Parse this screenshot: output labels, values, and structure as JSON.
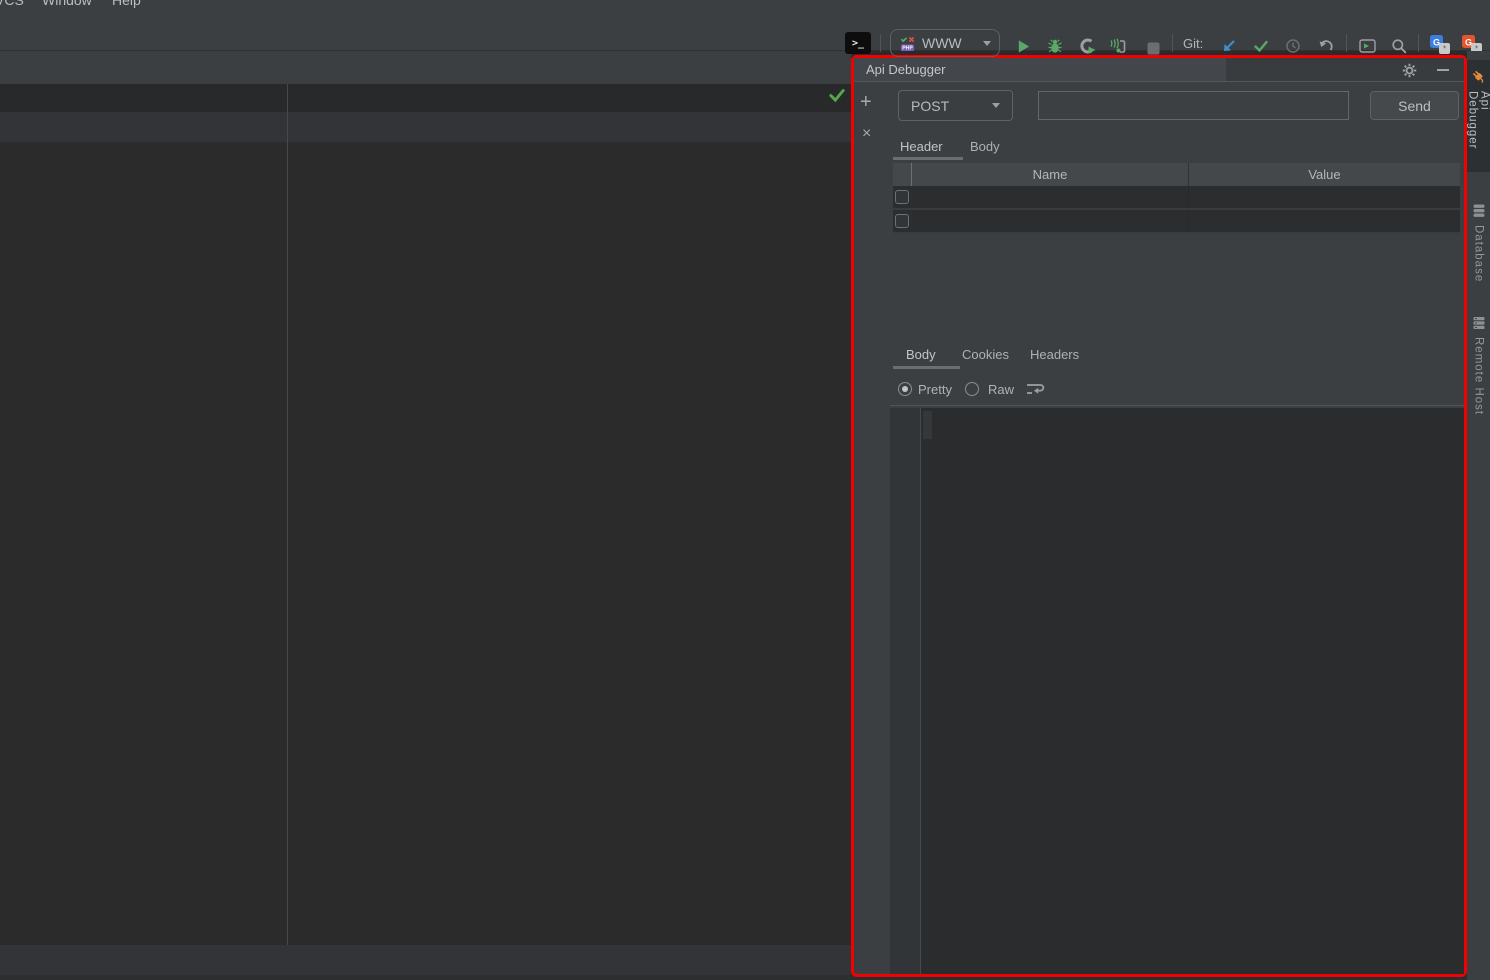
{
  "menubar": {
    "items": [
      {
        "label": "VCS"
      },
      {
        "label": "Window"
      },
      {
        "label": "Help"
      }
    ]
  },
  "toolbar": {
    "terminal_glyph": ">_",
    "run_config_label": "WWW",
    "git_label": "Git:"
  },
  "panel": {
    "title": "Api Debugger",
    "add_glyph": "+",
    "close_glyph": "×",
    "request": {
      "method": "POST",
      "url_value": "",
      "send_label": "Send",
      "tabs": [
        {
          "label": "Header",
          "selected": true
        },
        {
          "label": "Body",
          "selected": false
        }
      ],
      "table": {
        "columns": [
          "Name",
          "Value"
        ],
        "rows": [
          {
            "checked": false,
            "name": "",
            "value": ""
          },
          {
            "checked": false,
            "name": "",
            "value": ""
          }
        ]
      }
    },
    "response": {
      "tabs": [
        {
          "label": "Body",
          "selected": true
        },
        {
          "label": "Cookies",
          "selected": false
        },
        {
          "label": "Headers",
          "selected": false
        }
      ],
      "modes": [
        {
          "label": "Pretty",
          "selected": true
        },
        {
          "label": "Raw",
          "selected": false
        }
      ]
    }
  },
  "stripe": {
    "buttons": [
      {
        "label": "Api Debugger",
        "icon": "plug-icon",
        "active": true
      },
      {
        "label": "Database",
        "icon": "database-icon",
        "active": false
      },
      {
        "label": "Remote Host",
        "icon": "remote-host-icon",
        "active": false
      }
    ]
  },
  "colors": {
    "panel_bg": "#3c3f41",
    "editor_bg": "#2b2b2b",
    "highlight_border": "#f50000",
    "run_green": "#59a869",
    "git_update_blue": "#3a8fd0",
    "plug_orange": "#e08c3c",
    "translate_blue": "#3e7de0",
    "translate_orange": "#e2552e"
  }
}
